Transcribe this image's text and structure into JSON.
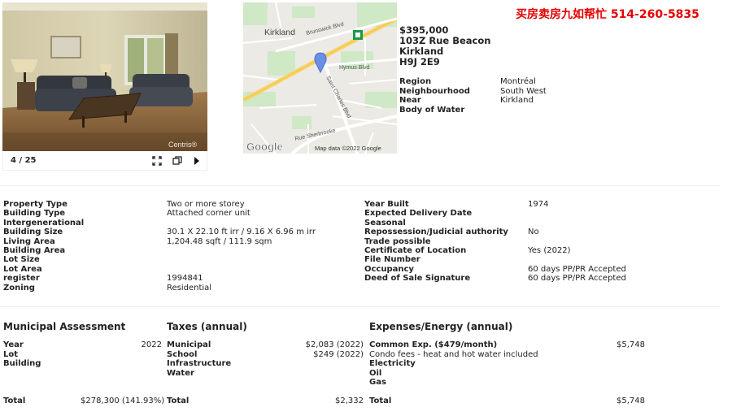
{
  "promo": "买房卖房九如帮忙 514-260-5835",
  "gallery": {
    "counter": "4 / 25",
    "watermark": "Centris®"
  },
  "map": {
    "labels": {
      "kirkland": "Kirkland",
      "brunswick": "Brunswick Blvd",
      "hymus": "Hymus Blvd",
      "saint_charles": "Saint Charles Blvd",
      "sherbrooke": "Rue Sherbrooke",
      "google": "Google",
      "attribution": "Map data ©2022 Google"
    }
  },
  "listing": {
    "price": "$395,000",
    "address1": "103Z Rue Beacon",
    "address2": "Kirkland",
    "postal": "H9J 2E9"
  },
  "location": [
    {
      "label": "Region",
      "value": "Montréal"
    },
    {
      "label": "Neighbourhood",
      "value": "South West"
    },
    {
      "label": "Near",
      "value": "Kirkland"
    },
    {
      "label": "Body of Water",
      "value": ""
    }
  ],
  "details_left": [
    {
      "label": "Property Type",
      "value": "Two or more storey"
    },
    {
      "label": "Building Type",
      "value": "Attached corner unit"
    },
    {
      "label": "Intergenerational",
      "value": ""
    },
    {
      "label": "Building Size",
      "value": "30.1 X 22.10 ft irr / 9.16 X 6.96 m irr"
    },
    {
      "label": "Living Area",
      "value": "1,204.48 sqft / 111.9 sqm"
    },
    {
      "label": "Building Area",
      "value": ""
    },
    {
      "label": "Lot Size",
      "value": ""
    },
    {
      "label": "Lot Area",
      "value": ""
    },
    {
      "label": "register",
      "value": "1994841"
    },
    {
      "label": "Zoning",
      "value": "Residential"
    }
  ],
  "details_right": [
    {
      "label": "Year Built",
      "value": "1974"
    },
    {
      "label": "Expected Delivery Date",
      "value": ""
    },
    {
      "label": "Seasonal",
      "value": ""
    },
    {
      "label": "Repossession/Judicial authority",
      "value": "No"
    },
    {
      "label": "Trade possible",
      "value": ""
    },
    {
      "label": "Certificate of Location",
      "value": "Yes (2022)"
    },
    {
      "label": "File Number",
      "value": ""
    },
    {
      "label": "Occupancy",
      "value": "60 days PP/PR Accepted"
    },
    {
      "label": "Deed of Sale Signature",
      "value": "60 days PP/PR Accepted"
    }
  ],
  "municipal": {
    "heading": "Municipal Assessment",
    "rows": [
      {
        "label": "Year",
        "value": "2022"
      },
      {
        "label": "Lot",
        "value": ""
      },
      {
        "label": "Building",
        "value": ""
      }
    ],
    "total_label": "Total",
    "total_value": "$278,300 (141.93%)"
  },
  "taxes": {
    "heading": "Taxes (annual)",
    "rows": [
      {
        "label": "Municipal",
        "value": "$2,083 (2022)"
      },
      {
        "label": "School",
        "value": "$249 (2022)"
      },
      {
        "label": "Infrastructure",
        "value": ""
      },
      {
        "label": "Water",
        "value": ""
      }
    ],
    "total_label": "Total",
    "total_value": "$2,332"
  },
  "expenses": {
    "heading": "Expenses/Energy (annual)",
    "common_label": "Common Exp. ($479/month)",
    "common_value": "$5,748",
    "condo_note": "Condo fees - heat and hot water included",
    "rows": [
      {
        "label": "Electricity"
      },
      {
        "label": "Oil"
      },
      {
        "label": "Gas"
      }
    ],
    "total_label": "Total",
    "total_value": "$5,748"
  }
}
